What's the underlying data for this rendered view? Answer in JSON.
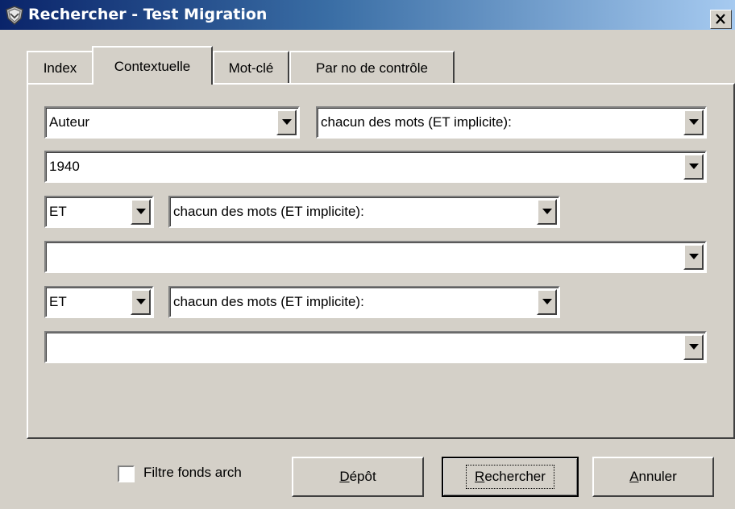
{
  "window": {
    "title": "Rechercher - Test Migration",
    "close_glyph": "×",
    "icon": "app-shield-icon"
  },
  "tabs": [
    {
      "label": "Index",
      "active": false
    },
    {
      "label": "Contextuelle",
      "active": true
    },
    {
      "label": "Mot-clé",
      "active": false
    },
    {
      "label": "Par no de contrôle",
      "active": false
    }
  ],
  "form": {
    "field1": {
      "value": "Auteur"
    },
    "mode1": {
      "value": "chacun des mots (ET implicite):"
    },
    "term1": {
      "value": "1940"
    },
    "op2": {
      "value": "ET"
    },
    "mode2": {
      "value": "chacun des mots (ET implicite):"
    },
    "term2": {
      "value": ""
    },
    "op3": {
      "value": "ET"
    },
    "mode3": {
      "value": "chacun des mots (ET implicite):"
    },
    "term3": {
      "value": ""
    }
  },
  "footer": {
    "filter_checkbox": {
      "label": "Filtre fonds arch",
      "checked": false
    },
    "depot_button": {
      "mnemonic": "D",
      "rest": "épôt"
    },
    "search_button": {
      "mnemonic": "R",
      "rest": "echercher"
    },
    "cancel_button": {
      "mnemonic": "A",
      "rest": "nnuler"
    }
  },
  "colors": {
    "title_gradient_start": "#0a246a",
    "title_gradient_end": "#a6caf0",
    "face": "#d4d0c8"
  }
}
